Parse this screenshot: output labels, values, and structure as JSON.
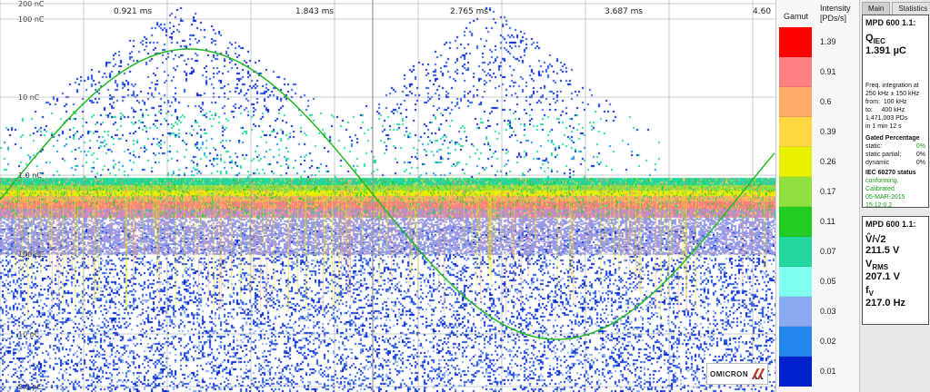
{
  "plot": {
    "time_labels": [
      "0.921 ms",
      "1.843 ms",
      "2.765 ms",
      "3.687 ms",
      "4.60"
    ],
    "y_labels": [
      "200 nC",
      "100 nC",
      "10 nC",
      "1.0 nC",
      "100 pC",
      "10 pC",
      "2.0 pC"
    ],
    "logo_text": "OMICRON"
  },
  "gamut": {
    "title": "Gamut",
    "intensity_title": "Intensity",
    "intensity_unit": "[PDs/s]",
    "levels": [
      {
        "label": "1.39",
        "color": "#ff0000"
      },
      {
        "label": "0.91",
        "color": "#ff8080"
      },
      {
        "label": "0.6",
        "color": "#ffaa66"
      },
      {
        "label": "0.39",
        "color": "#ffd740"
      },
      {
        "label": "0.26",
        "color": "#e6f000"
      },
      {
        "label": "0.17",
        "color": "#90e040"
      },
      {
        "label": "0.11",
        "color": "#22cc22"
      },
      {
        "label": "0.07",
        "color": "#22d8a0"
      },
      {
        "label": "0.05",
        "color": "#80ffee"
      },
      {
        "label": "0.03",
        "color": "#88aaee"
      },
      {
        "label": "0.02",
        "color": "#2288ee"
      },
      {
        "label": "0.01",
        "color": "#0022cc"
      }
    ]
  },
  "tabs": {
    "main": "Main",
    "statistics": "Statistics"
  },
  "charge_panel": {
    "title": "MPD 600 1.1:",
    "symbol": "Q",
    "symbol_sub": "IEC",
    "value": "1.391 µC",
    "freq_line1": "Freq. integration at",
    "freq_line2": "250 kHz ± 150 kHz",
    "from_label": "from:",
    "from_value": "100 kHz",
    "to_label": "to:",
    "to_value": "400 kHz",
    "pds": "1,471,003 PDs",
    "duration": "in 1 min 12 s",
    "gated_title": "Gated Percentage",
    "static_label": "static:",
    "static_value": "0%",
    "static_partial_label": "static partial:",
    "static_partial_value": "0%",
    "dynamic_label": "dynamic",
    "dynamic_value": "0%",
    "iec_title": "IEC 60270 status",
    "iec_status": "conforming. Calibrated",
    "iec_date": "05-MAR-2015",
    "iec_time": "15:12:0.2"
  },
  "voltage_panel": {
    "title": "MPD 600 1.1:",
    "v_sym": "V̂/√2",
    "v_value": "211.5 V",
    "rms_sym": "V",
    "rms_sub": "RMS",
    "rms_value": "207.1 V",
    "f_sym": "f",
    "f_sub": "V",
    "f_value": "217.0 Hz"
  },
  "colors": {
    "sine": "#22bb22",
    "grid": "#9a9a9a"
  }
}
